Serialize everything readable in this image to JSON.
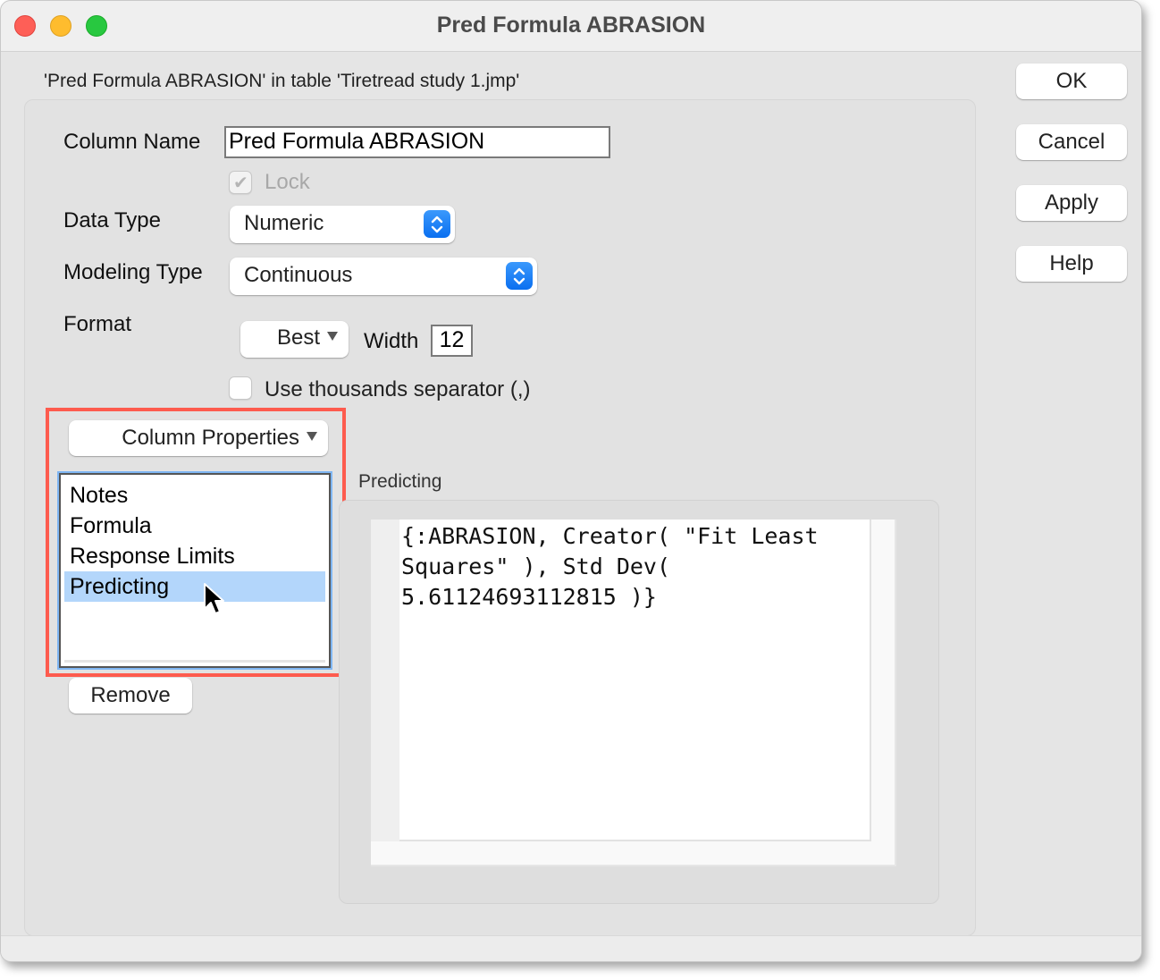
{
  "window": {
    "title": "Pred Formula ABRASION",
    "subtitle": "'Pred Formula ABRASION' in table 'Tiretread study 1.jmp'"
  },
  "form": {
    "column_name_label": "Column Name",
    "column_name_value": "Pred Formula ABRASION",
    "lock_label": "Lock",
    "lock_checked": true,
    "data_type_label": "Data Type",
    "data_type_value": "Numeric",
    "modeling_type_label": "Modeling Type",
    "modeling_type_value": "Continuous",
    "format_label": "Format",
    "format_value": "Best",
    "width_label": "Width",
    "width_value": "12",
    "thousands_label": "Use thousands separator (,)",
    "thousands_checked": false
  },
  "properties": {
    "menu_label": "Column Properties",
    "items": [
      {
        "label": "Notes",
        "selected": false
      },
      {
        "label": "Formula",
        "selected": false
      },
      {
        "label": "Response Limits",
        "selected": false
      },
      {
        "label": "Predicting",
        "selected": true
      }
    ],
    "remove_label": "Remove",
    "highlight_color": "#fd5b4e",
    "selection_color": "#b3d6fb"
  },
  "detail": {
    "label": "Predicting",
    "code": "{:ABRASION, Creator( \"Fit Least\nSquares\" ), Std Dev(\n5.61124693112815 )}"
  },
  "buttons": {
    "ok": "OK",
    "cancel": "Cancel",
    "apply": "Apply",
    "help": "Help"
  },
  "icons": {
    "close": "close-icon",
    "minimize": "minimize-icon",
    "zoom": "zoom-icon",
    "stepper": "updown-stepper-icon",
    "dropdown": "triangle-down-icon",
    "check": "checkmark-icon",
    "cursor": "mouse-pointer-icon"
  }
}
